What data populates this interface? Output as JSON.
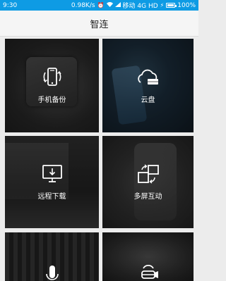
{
  "status_bar": {
    "time": "9:30",
    "speed": "0.98K/s",
    "carrier": "移动 4G HD",
    "battery": "100%",
    "battery_level": 1.0
  },
  "header": {
    "title": "智连"
  },
  "tiles": [
    {
      "label": "手机备份",
      "icon": "phone-backup-icon"
    },
    {
      "label": "云盘",
      "icon": "cloud-drive-icon"
    },
    {
      "label": "远程下载",
      "icon": "remote-download-icon"
    },
    {
      "label": "多屏互动",
      "icon": "multi-screen-icon"
    },
    {
      "label": "",
      "icon": "microphone-icon"
    },
    {
      "label": "",
      "icon": "vr-headset-icon"
    }
  ]
}
